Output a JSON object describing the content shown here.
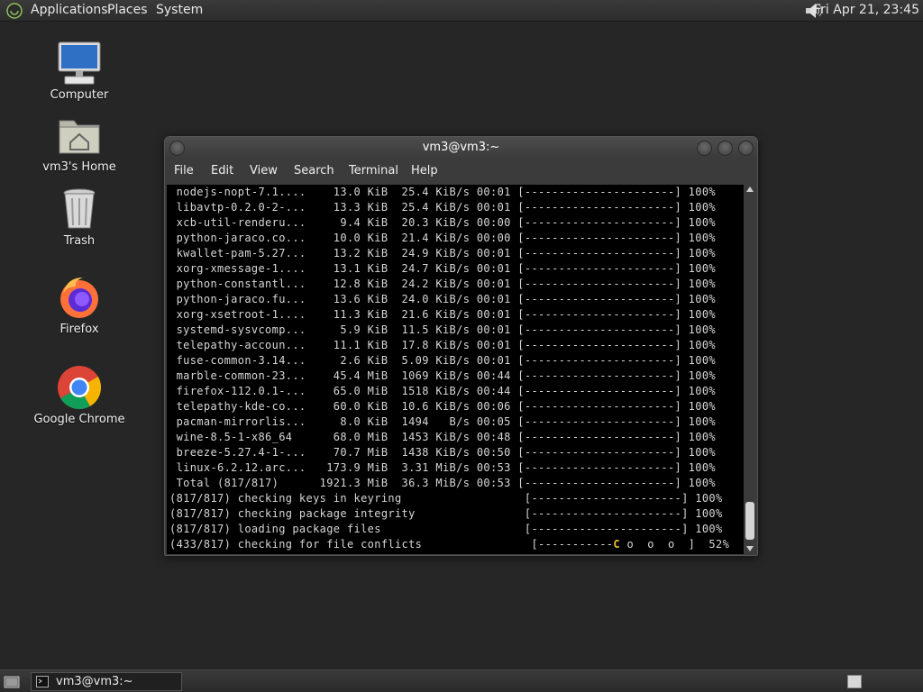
{
  "top_panel": {
    "menus": [
      "Applications",
      "Places",
      "System"
    ],
    "clock": "Fri Apr 21, 23:45",
    "volume_icon": "speaker-icon"
  },
  "desktop_icons": [
    {
      "label": "Computer",
      "icon": "computer-icon"
    },
    {
      "label": "vm3's Home",
      "icon": "home-folder-icon"
    },
    {
      "label": "Trash",
      "icon": "trash-icon"
    },
    {
      "label": "Firefox",
      "icon": "firefox-icon"
    },
    {
      "label": "Google Chrome",
      "icon": "chrome-icon"
    }
  ],
  "window": {
    "title": "vm3@vm3:~",
    "menu": [
      "File",
      "Edit",
      "View",
      "Search",
      "Terminal",
      "Help"
    ]
  },
  "terminal": {
    "lines": [
      " nodejs-nopt-7.1....    13.0 KiB  25.4 KiB/s 00:01 [----------------------] 100%",
      " libavtp-0.2.0-2-...    13.3 KiB  25.4 KiB/s 00:01 [----------------------] 100%",
      " xcb-util-renderu...     9.4 KiB  20.3 KiB/s 00:00 [----------------------] 100%",
      " python-jaraco.co...    10.0 KiB  21.4 KiB/s 00:00 [----------------------] 100%",
      " kwallet-pam-5.27...    13.2 KiB  24.9 KiB/s 00:01 [----------------------] 100%",
      " xorg-xmessage-1....    13.1 KiB  24.7 KiB/s 00:01 [----------------------] 100%",
      " python-constantl...    12.8 KiB  24.2 KiB/s 00:01 [----------------------] 100%",
      " python-jaraco.fu...    13.6 KiB  24.0 KiB/s 00:01 [----------------------] 100%",
      " xorg-xsetroot-1....    11.3 KiB  21.6 KiB/s 00:01 [----------------------] 100%",
      " systemd-sysvcomp...     5.9 KiB  11.5 KiB/s 00:01 [----------------------] 100%",
      " telepathy-accoun...    11.1 KiB  17.8 KiB/s 00:01 [----------------------] 100%",
      " fuse-common-3.14...     2.6 KiB  5.09 KiB/s 00:01 [----------------------] 100%",
      " marble-common-23...    45.4 MiB  1069 KiB/s 00:44 [----------------------] 100%",
      " firefox-112.0.1-...    65.0 MiB  1518 KiB/s 00:44 [----------------------] 100%",
      " telepathy-kde-co...    60.0 KiB  10.6 KiB/s 00:06 [----------------------] 100%",
      " pacman-mirrorlis...     8.0 KiB  1494   B/s 00:05 [----------------------] 100%",
      " wine-8.5-1-x86_64      68.0 MiB  1453 KiB/s 00:48 [----------------------] 100%",
      " breeze-5.27.4-1-...    70.7 MiB  1438 KiB/s 00:50 [----------------------] 100%",
      " linux-6.2.12.arc...   173.9 MiB  3.31 MiB/s 00:53 [----------------------] 100%",
      " Total (817/817)      1921.3 MiB  36.3 MiB/s 00:53 [----------------------] 100%",
      "(817/817) checking keys in keyring                  [----------------------] 100%",
      "(817/817) checking package integrity                [----------------------] 100%",
      "(817/817) loading package files                     [----------------------] 100%"
    ],
    "progress_line": {
      "prefix": "(433/817) checking for file conflicts                [-----------",
      "pacman": "C",
      "dots": " o  o  o  ]",
      "percent": "  52%"
    }
  },
  "bottom_panel": {
    "task_label": "vm3@vm3:~",
    "show_desktop_icon": "show-desktop-icon",
    "workspace_icon": "workspace-switcher-icon"
  }
}
